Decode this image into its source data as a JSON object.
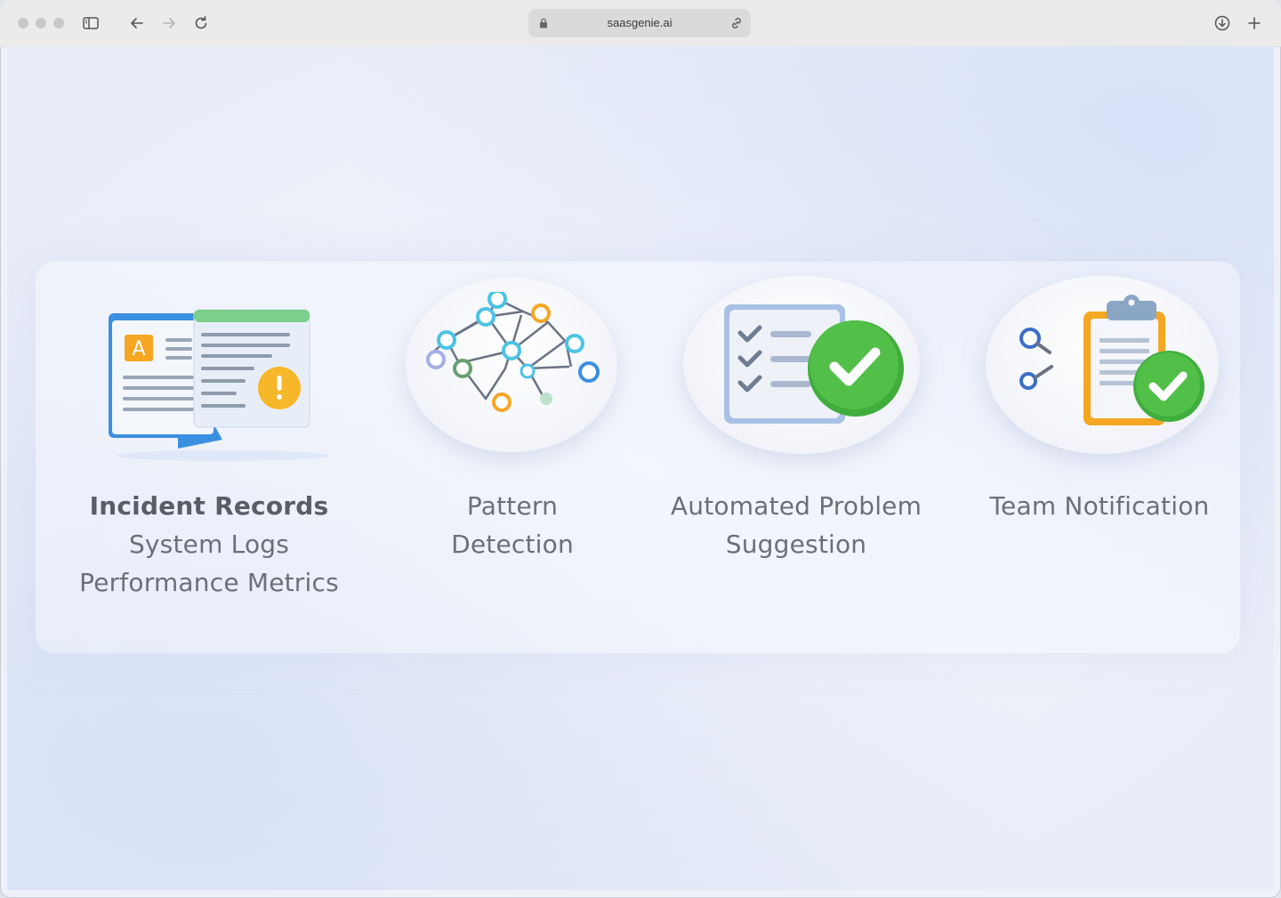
{
  "browser": {
    "url": "saasgenie.ai"
  },
  "features": [
    {
      "id": "incident",
      "lines": [
        "Incident Records",
        "System Logs",
        "Performance Metrics"
      ]
    },
    {
      "id": "pattern",
      "lines": [
        "Pattern",
        "Detection"
      ]
    },
    {
      "id": "automated",
      "lines": [
        "Automated Problem",
        "Suggestion"
      ]
    },
    {
      "id": "team",
      "lines": [
        "Team Notification"
      ]
    }
  ],
  "colors": {
    "accent_blue": "#3b8fe0",
    "green_check": "#3fae3c",
    "orange": "#f5a623",
    "text": "#6b6f78"
  }
}
